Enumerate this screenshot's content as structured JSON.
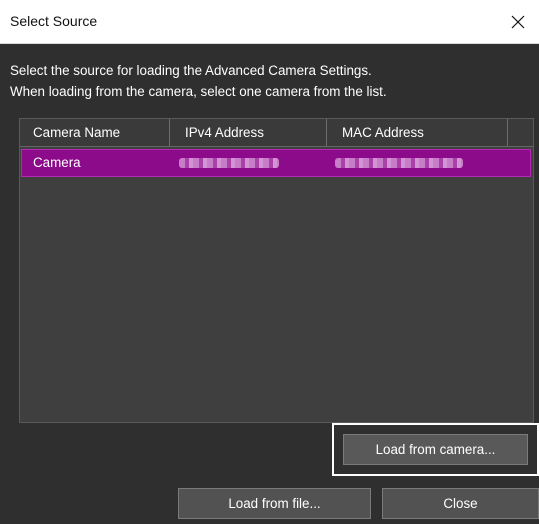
{
  "window": {
    "title": "Select Source",
    "close_icon": "close-icon"
  },
  "instructions": {
    "line1": "Select the source for loading the Advanced Camera Settings.",
    "line2": "When loading from the camera, select one camera from the list."
  },
  "list": {
    "columns": [
      "Camera Name",
      "IPv4 Address",
      "MAC Address",
      ""
    ],
    "rows": [
      {
        "name": "Camera",
        "ipv4": "",
        "mac": "",
        "selected": true
      }
    ]
  },
  "buttons": {
    "load_from_camera": "Load from camera...",
    "load_from_file": "Load from file...",
    "close": "Close"
  },
  "colors": {
    "selection": "#8b0b8b",
    "background": "#2f2f2f"
  }
}
